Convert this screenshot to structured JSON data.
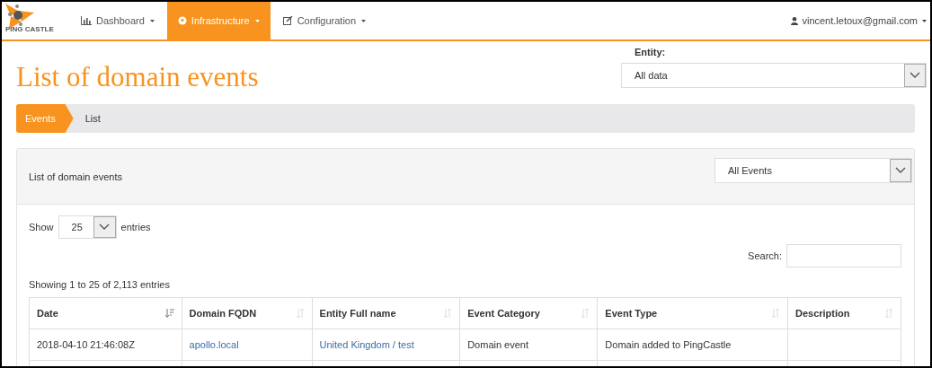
{
  "navbar": {
    "logo_text": "PING CASTLE",
    "items": [
      {
        "label": "Dashboard",
        "kind": "chart",
        "selected": false
      },
      {
        "label": "Infrastructure",
        "kind": "pin",
        "selected": true
      },
      {
        "label": "Configuration",
        "kind": "edit",
        "selected": false
      }
    ],
    "user": "vincent.letoux@gmail.com"
  },
  "page_title": "List of domain events",
  "entity_filter": {
    "label": "Entity:",
    "value": "All data"
  },
  "breadcrumb": [
    "Events",
    "List"
  ],
  "panel": {
    "title": "List of domain events",
    "filter_value": "All Events"
  },
  "length_control": {
    "prefix": "Show",
    "value": "25",
    "suffix": "entries"
  },
  "search": {
    "label": "Search:"
  },
  "info": "Showing 1 to 25 of 2,113 entries",
  "table": {
    "columns": [
      {
        "label": "Date",
        "sorted": true
      },
      {
        "label": "Domain FQDN",
        "sorted": false
      },
      {
        "label": "Entity Full name",
        "sorted": false
      },
      {
        "label": "Event Category",
        "sorted": false
      },
      {
        "label": "Event Type",
        "sorted": false
      },
      {
        "label": "Description",
        "sorted": false
      }
    ],
    "rows": [
      {
        "cells": [
          {
            "text": "2018-04-10 21:46:08Z",
            "kind": "text"
          },
          {
            "text": "apollo.local",
            "kind": "link"
          },
          {
            "text": "United Kingdom / test",
            "kind": "link"
          },
          {
            "text": "Domain event",
            "kind": "text"
          },
          {
            "text": "Domain added to PingCastle",
            "kind": "text"
          }
        ]
      }
    ]
  }
}
